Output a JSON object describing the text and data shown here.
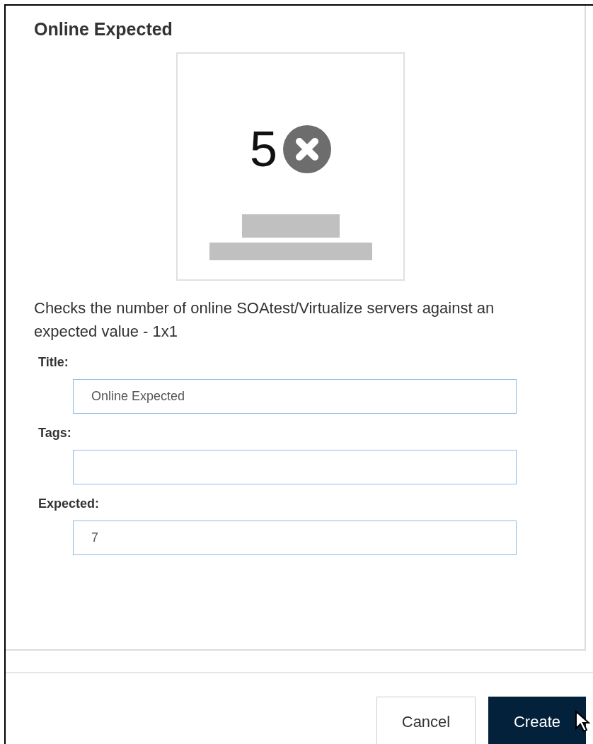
{
  "dialog": {
    "title": "Online Expected",
    "preview": {
      "value": "5",
      "passing": false
    },
    "description": "Checks the number of online SOAtest/Virtualize servers against an expected value - 1x1",
    "fields": [
      {
        "label": "Title:",
        "value": "Online Expected"
      },
      {
        "label": "Tags:"
      },
      {
        "label": "Expected:",
        "value": "7"
      }
    ],
    "buttons": [
      {
        "label": "Cancel",
        "kind": "secondary"
      },
      {
        "label": "Create",
        "kind": "primary"
      }
    ]
  }
}
